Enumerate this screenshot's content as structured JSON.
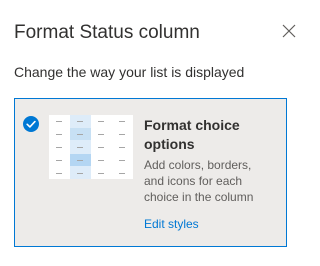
{
  "panel": {
    "title": "Format Status column",
    "close_icon": "close-icon",
    "subtitle": "Change the way your list is displayed"
  },
  "option_card": {
    "selected": true,
    "check_icon": "checkmark-circle-icon",
    "thumbnail_icon": "choice-table-preview-icon",
    "title": "Format choice options",
    "description": "Add colors, borders, and icons for each choice in the column",
    "link": "Edit styles"
  },
  "colors": {
    "accent": "#0078d4",
    "card_background": "#edebe9",
    "text": "#323130",
    "secondary_text": "#605e5c",
    "thumbnail_highlight_light": "#deecf9",
    "thumbnail_highlight_dark": "#c7e0f4"
  }
}
